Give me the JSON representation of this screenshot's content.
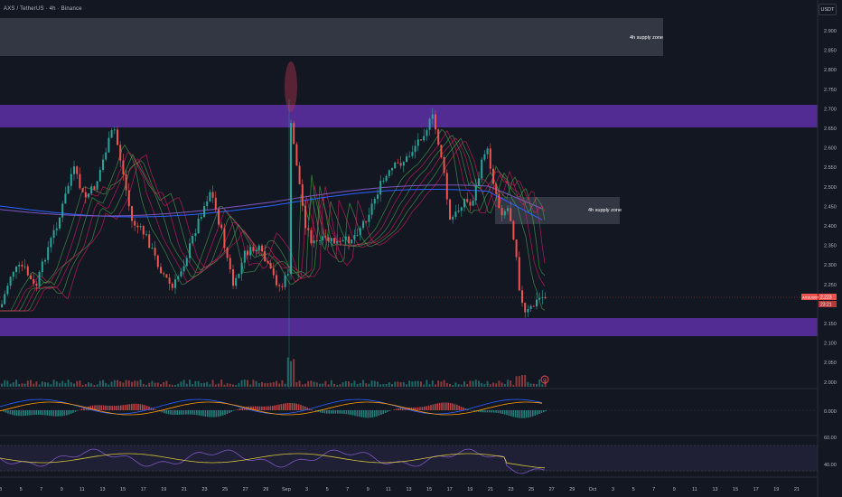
{
  "header": {
    "title": "AXS / TetherUS · 4h · Binance",
    "currency": "USDT"
  },
  "zones": {
    "upper_label": "4h supply zone",
    "mid_label": "4h supply zone"
  },
  "price_tag": {
    "symbol": "AXSUSDT",
    "price": "2.223",
    "countdown": "23:21"
  },
  "price_axis": {
    "ticks": [
      "2.900",
      "2.850",
      "2.800",
      "2.750",
      "2.700",
      "2.650",
      "2.600",
      "2.550",
      "2.500",
      "2.450",
      "2.400",
      "2.350",
      "2.300",
      "2.250",
      "2.200",
      "2.150",
      "2.100",
      "2.050",
      "2.000"
    ]
  },
  "macd_axis": {
    "zero": "0.000"
  },
  "rsi_axis": {
    "upper": "60.00",
    "lower": "40.00"
  },
  "time_axis": {
    "labels": [
      "3",
      "5",
      "7",
      "9",
      "11",
      "13",
      "15",
      "17",
      "19",
      "21",
      "23",
      "25",
      "27",
      "29",
      "Sep",
      "3",
      "5",
      "7",
      "9",
      "11",
      "13",
      "15",
      "17",
      "19",
      "21",
      "23",
      "25",
      "27",
      "29",
      "Oct",
      "3",
      "5",
      "7",
      "9",
      "11",
      "13",
      "15",
      "17",
      "19",
      "21"
    ]
  },
  "colors": {
    "background": "#131722",
    "up": "#26a69a",
    "down": "#ef5350",
    "zone_purple": "#5b2fa0",
    "supply_gray": "#3a3d49",
    "ma_blue": "#2962ff",
    "ma_purple": "#7e57c2"
  }
}
